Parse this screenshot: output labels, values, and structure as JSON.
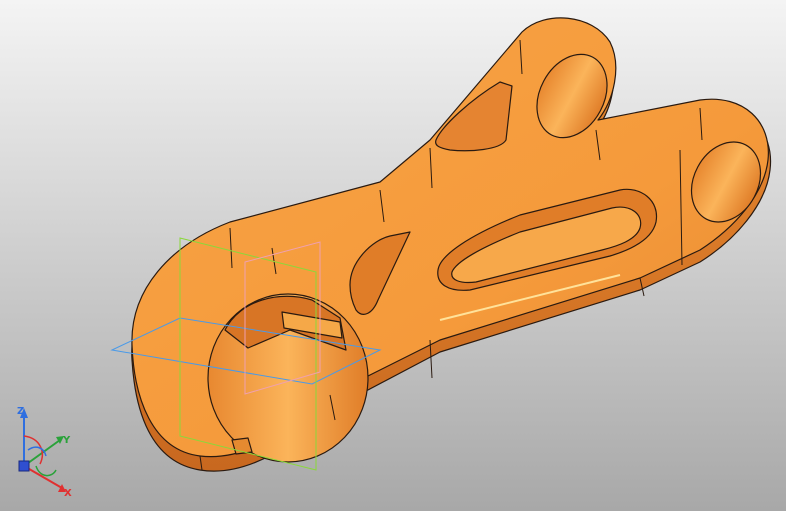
{
  "viewport": {
    "background_top": "#f2f2f2",
    "background_bottom": "#a9a9a9",
    "part_color": "#f59a3b",
    "part_shadow": "#d9762a",
    "part_highlight": "#ffd27a",
    "edge_color": "#2a1a10"
  },
  "triad": {
    "z_label": "Z",
    "y_label": "Y",
    "x_label": "X",
    "z_color": "#2f6fe0",
    "y_color": "#2aa23a",
    "x_color": "#e03030"
  },
  "planes": {
    "xy_color": "#4a9ae8",
    "yz_color": "#8ad83a",
    "zx_color": "#f0a0b0"
  }
}
